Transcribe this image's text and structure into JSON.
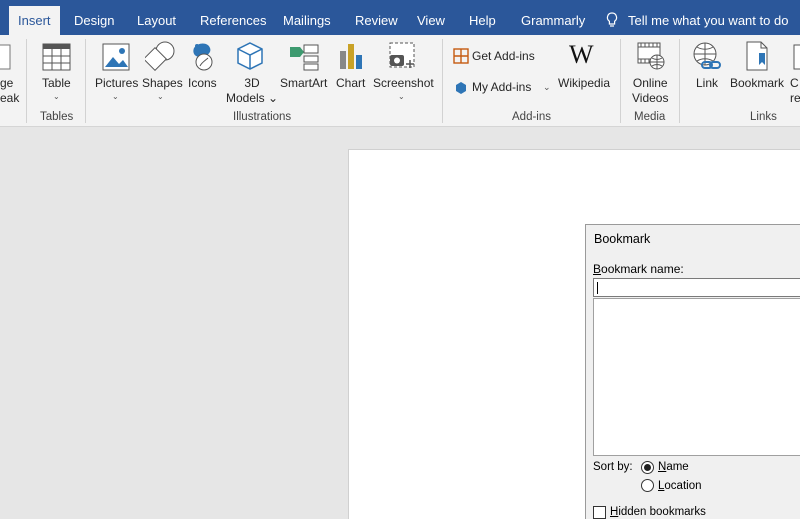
{
  "tabs": [
    {
      "label": "Insert",
      "active": true
    },
    {
      "label": "Design"
    },
    {
      "label": "Layout"
    },
    {
      "label": "References"
    },
    {
      "label": "Mailings"
    },
    {
      "label": "Review"
    },
    {
      "label": "View"
    },
    {
      "label": "Help"
    },
    {
      "label": "Grammarly"
    }
  ],
  "tell_me": "Tell me what you want to do",
  "ribbon": {
    "page_break": {
      "line1": "ge",
      "line2": "eak"
    },
    "table": "Table",
    "pictures": "Pictures",
    "shapes": "Shapes",
    "icons": "Icons",
    "models_3d": {
      "line1": "3D",
      "line2": "Models"
    },
    "smartart": "SmartArt",
    "chart": "Chart",
    "screenshot": "Screenshot",
    "get_addins": "Get Add-ins",
    "my_addins": "My Add-ins",
    "wikipedia": "Wikipedia",
    "online_videos": {
      "line1": "Online",
      "line2": "Videos"
    },
    "link": "Link",
    "bookmark": "Bookmark",
    "cross_ref": {
      "line1": "C",
      "line2": "re"
    },
    "groups": {
      "tables": "Tables",
      "illustrations": "Illustrations",
      "addins": "Add-ins",
      "media": "Media",
      "links": "Links"
    }
  },
  "dialog": {
    "title": "Bookmark",
    "name_label_u": "B",
    "name_label_rest": "ookmark name:",
    "name_value": "",
    "sort_by": "Sort by:",
    "sort_name_u": "N",
    "sort_name_rest": "ame",
    "sort_location_u": "L",
    "sort_location_rest": "ocation",
    "hidden_u": "H",
    "hidden_rest": "idden bookmarks"
  },
  "colors": {
    "accent": "#2b579a",
    "ribbon_bg": "#f3f3f3"
  }
}
